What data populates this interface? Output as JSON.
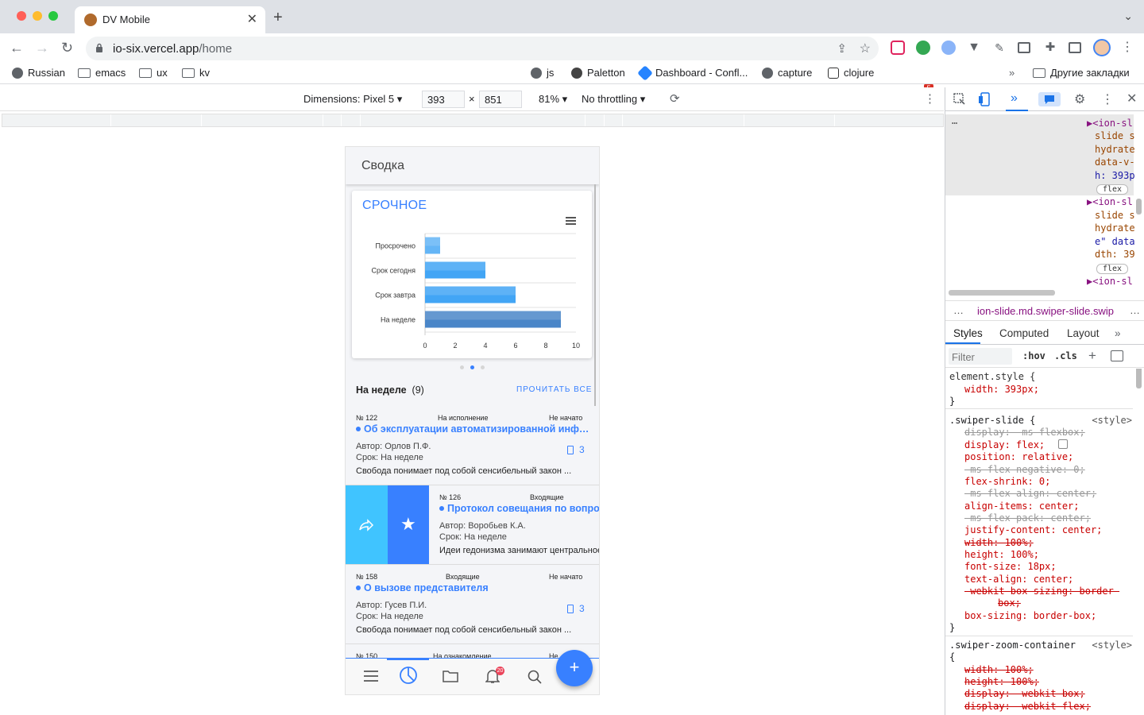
{
  "browser": {
    "tab_title": "DV Mobile",
    "url_domain": "io-six.vercel.app",
    "url_path": "/home",
    "ext_badge": "5",
    "bookmarks": [
      "Russian",
      "emacs",
      "ux",
      "kv",
      "js",
      "Paletton",
      "Dashboard - Confl...",
      "capture",
      "clojure"
    ],
    "other_bookmarks": "Другие закладки"
  },
  "device_toolbar": {
    "dimensions_label": "Dimensions: Pixel 5",
    "width": "393",
    "times": "×",
    "height": "851",
    "zoom": "81%",
    "throttle": "No throttling"
  },
  "app": {
    "header_title": "Сводка",
    "card_title": "СРОЧНОЕ",
    "section_title": "На неделе",
    "section_count": "(9)",
    "read_all": "ПРОЧИТАТЬ ВСЕ",
    "items": [
      {
        "num": "№ 122",
        "status1": "На исполнение",
        "status2": "Не начато",
        "title": "Об эксплуатации автоматизированной информационной системы",
        "author": "Автор: Орлов П.Ф.",
        "due": "Срок: На неделе",
        "body": "Свобода понимает под собой сенсибельный закон ...",
        "count": "3"
      },
      {
        "num": "№ 126",
        "status1": "Входящие",
        "status2": "",
        "title": "Протокол совещания по вопросам",
        "author": "Автор: Воробьев К.А.",
        "due": "Срок: На неделе",
        "body": "Идеи гедонизма занимают центральное",
        "count": ""
      },
      {
        "num": "№ 158",
        "status1": "Входящие",
        "status2": "Не начато",
        "title": "О вызове представителя",
        "author": "Автор: Гусев П.И.",
        "due": "Срок: На неделе",
        "body": "Свобода понимает под собой сенсибельный закон ...",
        "count": "3"
      },
      {
        "num": "№ 150",
        "status1": "На ознакомление",
        "status2": "Не",
        "title": "",
        "author": "",
        "due": "",
        "body": "",
        "count": ""
      }
    ],
    "notif_badge": "20",
    "fab_label": "+"
  },
  "chart_data": {
    "type": "bar",
    "orientation": "horizontal",
    "title": "СРОЧНОЕ",
    "categories": [
      "Просрочено",
      "Срок сегодня",
      "Срок завтра",
      "На неделе"
    ],
    "values": [
      1,
      4,
      6,
      9
    ],
    "xlim": [
      0,
      10
    ],
    "xticks": [
      "0",
      "2",
      "4",
      "6",
      "8",
      "10"
    ],
    "colors": [
      "#64b5f6",
      "#42a5f5",
      "#42a5f5",
      "#4a86c8"
    ],
    "grid": true
  },
  "devtools": {
    "elements_lines": [
      "▶<ion-sl",
      "slide s",
      "hydrate",
      "data-v-",
      "h: 393p",
      "<ion-sl",
      "slide s",
      "hydrate",
      "e\" data",
      "dth: 39",
      "▶<ion-sl"
    ],
    "flex_badge": "flex",
    "breadcrumb": "ion-slide.md.swiper-slide.swip",
    "tabs": [
      "Styles",
      "Computed",
      "Layout"
    ],
    "filter_placeholder": "Filter",
    "hov": ":hov",
    "cls": ".cls",
    "element_style": "element.style {",
    "rules": [
      {
        "selector": ".swiper-slide {",
        "source": "<style>"
      },
      {
        "selector": ".swiper-zoom-container",
        "source": "<style>"
      }
    ],
    "decls": [
      "width: 393px;",
      "display: -ms-flexbox;",
      "display: flex;",
      "position: relative;",
      "-ms-flex-negative: 0;",
      "flex-shrink: 0;",
      "-ms-flex-align: center;",
      "align-items: center;",
      "-ms-flex-pack: center;",
      "justify-content: center;",
      "width: 100%;",
      "height: 100%;",
      "font-size: 18px;",
      "text-align: center;",
      "-webkit-box-sizing: border-",
      "box;",
      "box-sizing: border-box;",
      "width: 100%;",
      "height: 100%;",
      "display: -webkit-box;",
      "display: -webkit-flex;"
    ]
  }
}
